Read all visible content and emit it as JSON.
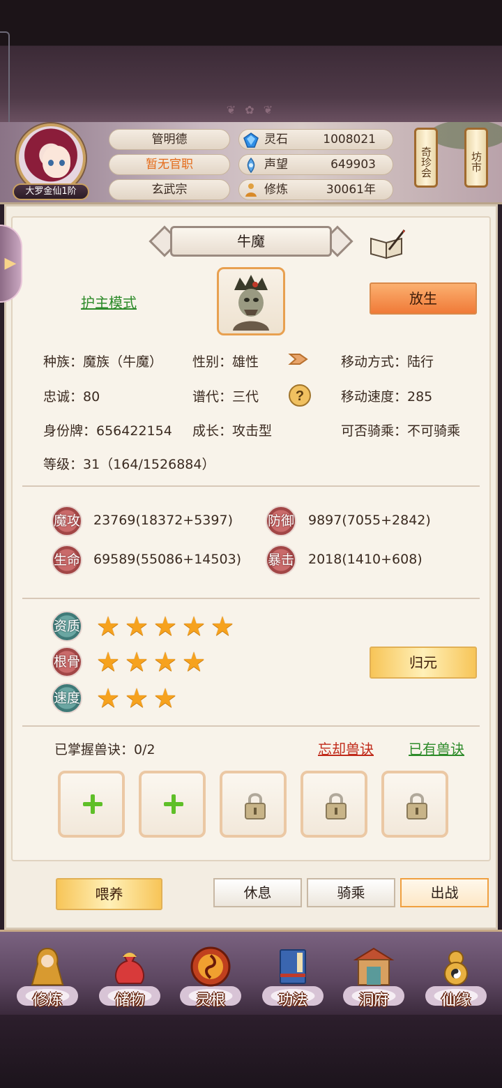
{
  "player": {
    "name": "管明德",
    "office": "暂无官职",
    "sect": "玄武宗",
    "rank": "大罗金仙1阶"
  },
  "resources": [
    {
      "icon": "spirit-stone-icon",
      "label": "灵石",
      "value": "1008021"
    },
    {
      "icon": "reputation-icon",
      "label": "声望",
      "value": "649903"
    },
    {
      "icon": "cultivation-icon",
      "label": "修炼",
      "value": "30061年"
    }
  ],
  "top_buttons": {
    "treasure_fair": "奇珍会",
    "market": "坊市"
  },
  "pet": {
    "name": "牛魔",
    "guard_mode": "护主模式",
    "release": "放生",
    "race": "种族：魔族（牛魔）",
    "gender": "性别：雄性",
    "move_type": "移动方式：陆行",
    "loyalty": "忠诚：80",
    "generation": "谱代：三代",
    "move_speed": "移动速度：285",
    "id_tag": "身份牌：656422154",
    "growth": "成长：攻击型",
    "rideable": "可否骑乘：不可骑乘",
    "level": "等级：31（164/1526884）"
  },
  "stats": [
    {
      "badge": "魔攻",
      "value": "23769(18372+5397)"
    },
    {
      "badge": "防御",
      "value": "9897(7055+2842)"
    },
    {
      "badge": "生命",
      "value": "69589(55086+14503)"
    },
    {
      "badge": "暴击",
      "value": "2018(1410+608)"
    }
  ],
  "qualities": [
    {
      "badge": "资质",
      "stars": 5
    },
    {
      "badge": "根骨",
      "stars": 4
    },
    {
      "badge": "速度",
      "stars": 3
    }
  ],
  "reset_button": "归元",
  "skills": {
    "mastered": "已掌握兽诀：0/2",
    "forget": "忘却兽诀",
    "owned": "已有兽诀",
    "slots": [
      "add",
      "add",
      "locked",
      "locked",
      "locked"
    ]
  },
  "actions": {
    "feed": "喂养",
    "rest": "休息",
    "ride": "骑乘",
    "battle": "出战"
  },
  "nav": [
    {
      "label": "修炼",
      "icon": "cultivate-icon"
    },
    {
      "label": "储物",
      "icon": "storage-bag-icon"
    },
    {
      "label": "灵根",
      "icon": "spirit-root-icon"
    },
    {
      "label": "功法",
      "icon": "technique-book-icon"
    },
    {
      "label": "洞府",
      "icon": "cave-dwelling-icon"
    },
    {
      "label": "仙缘",
      "icon": "fate-gourd-icon"
    }
  ],
  "colors": {
    "accent_orange": "#f07a38",
    "gold": "#f7c558",
    "link_green": "#2e8b2a",
    "link_red": "#c02a1a",
    "star": "#f6a21e"
  }
}
